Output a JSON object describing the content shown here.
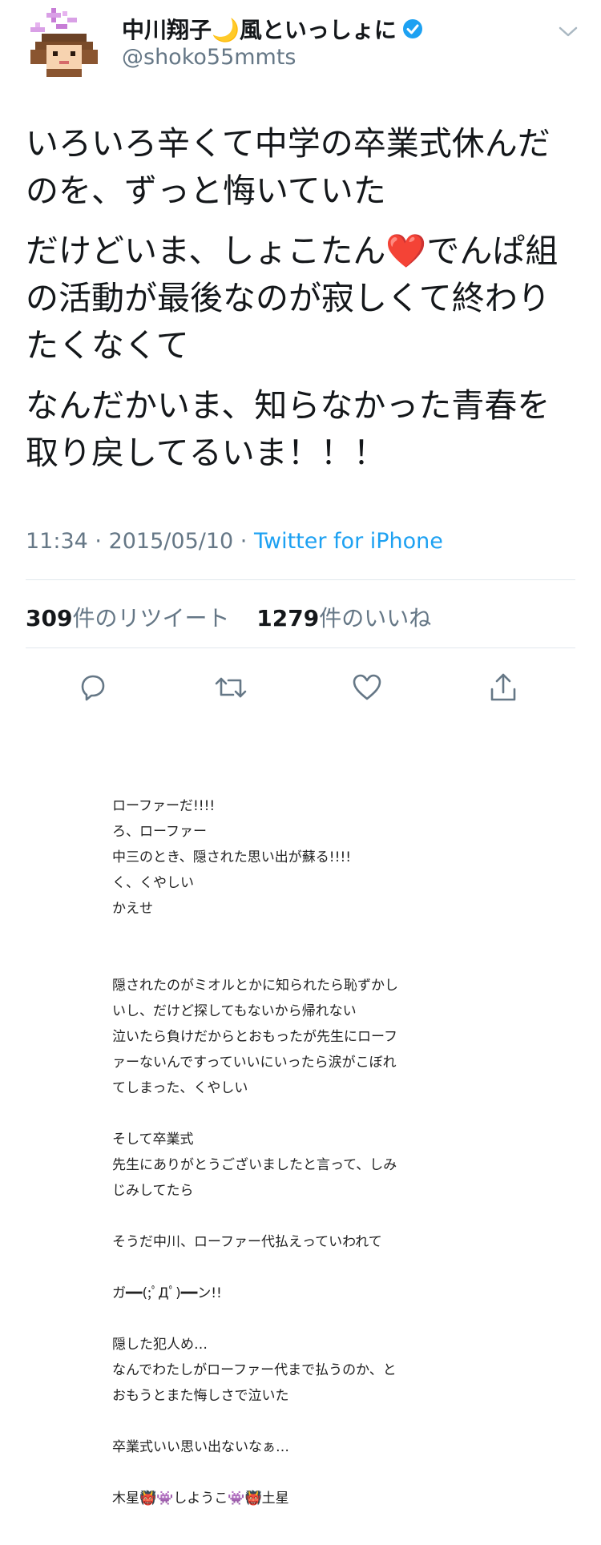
{
  "user": {
    "name": "中川翔子🌙風といっしょに",
    "handle": "@shoko55mmts",
    "verified": true
  },
  "tweet": {
    "paragraphs": [
      "いろいろ辛くて中学の卒業式休んだのを、ずっと悔いていた",
      "だけどいま、しょこたん❤️でんぱ組の活動が最後なのが寂しくて終わりたくなくて",
      "なんだかいま、知らなかった青春を取り戻してるいま！！！"
    ],
    "time": "11:34",
    "date": "2015/05/10",
    "source": "Twitter for iPhone"
  },
  "stats": {
    "retweets_count": "309",
    "retweets_label": "件のリツイート",
    "likes_count": "1279",
    "likes_label": "件のいいね"
  },
  "actions": [
    "reply-icon",
    "retweet-icon",
    "like-icon",
    "share-icon"
  ],
  "image_text": [
    "ローファーだ!!!!",
    "ろ、ローファー",
    "中三のとき、隠された思い出が蘇る!!!!",
    "く、くやしい",
    "かえせ",
    "",
    "",
    "隠されたのがミオルとかに知られたら恥ずかし",
    "いし、だけど探してもないから帰れない",
    "泣いたら負けだからとおもったが先生にローフ",
    "ァーないんですっていいにいったら涙がこぼれ",
    "てしまった、くやしい",
    "",
    "そして卒業式",
    "先生にありがとうございましたと言って、しみ",
    "じみしてたら",
    "",
    "そうだ中川、ローファー代払えっていわれて",
    "",
    "ガ━━(;ﾟДﾟ)━━ン!!",
    "",
    "隠した犯人め…",
    "なんでわたしがローファー代まで払うのか、と",
    "おもうとまた悔しさで泣いた",
    "",
    "卒業式いい思い出ないなぁ…",
    "",
    "木星👹👾しようこ👾👹土星"
  ],
  "colors": {
    "text": "#14171a",
    "secondary": "#657786",
    "link": "#1da1f2",
    "divider": "#e1e8ed",
    "verified": "#1da1f2"
  }
}
